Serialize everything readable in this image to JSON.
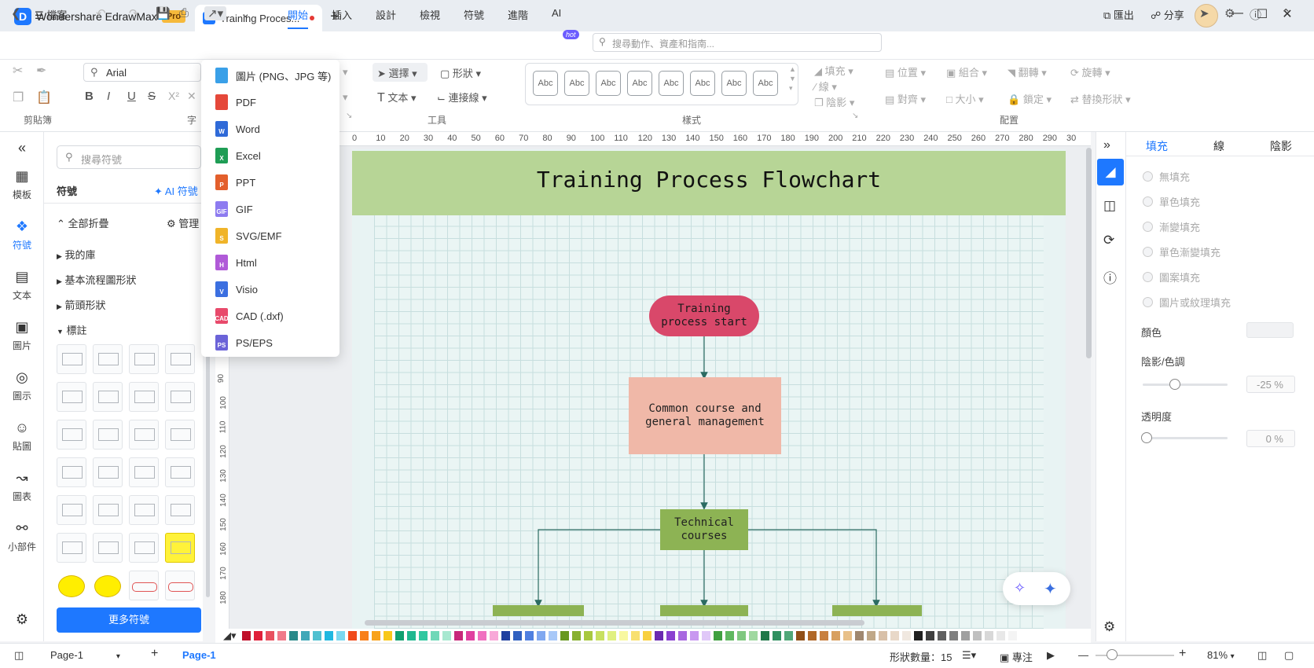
{
  "app": {
    "name": "Wondershare EdrawMax",
    "badge": "Pro"
  },
  "doc_tab": {
    "title": "Training Proces...",
    "icon": "E"
  },
  "menubar": {
    "file": "檔案",
    "tabs": [
      "開始",
      "插入",
      "設計",
      "檢視",
      "符號",
      "進階",
      "AI"
    ],
    "hot": "hot",
    "search_placeholder": "搜尋動作、資產和指南...",
    "export": "匯出",
    "share": "分享"
  },
  "ribbon": {
    "font": "Arial",
    "clipboard_label": "剪貼簿",
    "font_label_partial": "字",
    "tools_label": "工具",
    "styles_label": "樣式",
    "arrange_label": "配置",
    "select": "選擇",
    "shape": "形狀",
    "text": "文本",
    "connector": "連接線",
    "fill": "填充",
    "line": "線",
    "shadow": "陰影",
    "position": "位置",
    "group": "組合",
    "flip": "翻轉",
    "rotate": "旋轉",
    "align": "對齊",
    "size": "大小",
    "lock": "鎖定",
    "replace_shape": "替換形狀",
    "abc": "Abc"
  },
  "leftrail": [
    "模板",
    "符號",
    "文本",
    "圖片",
    "圖示",
    "貼圖",
    "圖表",
    "小部件"
  ],
  "symbols": {
    "search_placeholder": "搜尋符號",
    "title": "符號",
    "ai_symbols": "AI 符號",
    "collapse_all": "全部折疊",
    "manage": "管理",
    "categories": [
      "我的庫",
      "基本流程圖形狀",
      "箭頭形狀",
      "標註"
    ],
    "more_button": "更多符號"
  },
  "export_menu": [
    {
      "label": "圖片 (PNG、JPG 等)",
      "color": "#3aa0e8",
      "tag": ""
    },
    {
      "label": "PDF",
      "color": "#e5483a",
      "tag": ""
    },
    {
      "label": "Word",
      "color": "#2f6ad8",
      "tag": "W"
    },
    {
      "label": "Excel",
      "color": "#1f9d55",
      "tag": "X"
    },
    {
      "label": "PPT",
      "color": "#e35f2c",
      "tag": "P"
    },
    {
      "label": "GIF",
      "color": "#8d7bf0",
      "tag": "GIF"
    },
    {
      "label": "SVG/EMF",
      "color": "#f0b429",
      "tag": "S"
    },
    {
      "label": "Html",
      "color": "#b05ad8",
      "tag": "H"
    },
    {
      "label": "Visio",
      "color": "#3b6fe0",
      "tag": "V"
    },
    {
      "label": "CAD (.dxf)",
      "color": "#e84a6b",
      "tag": "CAD"
    },
    {
      "label": "PS/EPS",
      "color": "#6b63d8",
      "tag": "PS"
    }
  ],
  "ruler_h": [
    "0",
    "10",
    "20",
    "30",
    "40",
    "50",
    "60",
    "70",
    "80",
    "90",
    "100",
    "110",
    "120",
    "130",
    "140",
    "150",
    "160",
    "170",
    "180",
    "190",
    "200",
    "210",
    "220",
    "230",
    "240",
    "250",
    "260",
    "270",
    "280",
    "290",
    "30"
  ],
  "ruler_v": [
    "90",
    "100",
    "110",
    "120",
    "130",
    "140",
    "150",
    "160",
    "170",
    "180"
  ],
  "diagram": {
    "title": "Training Process Flowchart",
    "start": "Training\nprocess start",
    "common": "Common course and\ngeneral management",
    "technical": "Technical\ncourses",
    "colors": {
      "banner": "#b7d596",
      "start": "#d9486a",
      "common": "#f0b8a8",
      "technical": "#8db354"
    }
  },
  "rightpanel": {
    "tabs": [
      "填充",
      "線",
      "陰影"
    ],
    "fill_options": [
      "無填充",
      "單色填充",
      "漸變填充",
      "單色漸變填充",
      "圖案填充",
      "圖片或紋理填充"
    ],
    "color_label": "顏色",
    "shade_label": "陰影/色調",
    "shade_value": "-25 %",
    "transparency_label": "透明度",
    "transparency_value": "0 %"
  },
  "status": {
    "page_select": "Page-1",
    "page_tab": "Page-1",
    "shape_count_label": "形狀數量：",
    "shape_count": "15",
    "focus": "專注",
    "zoom": "81%"
  },
  "palette": [
    "#c0102a",
    "#e0203a",
    "#e8505f",
    "#f07a8a",
    "#2a8a8a",
    "#40a8b8",
    "#50c0d0",
    "#20b8e0",
    "#7ad8f0",
    "#f04a1a",
    "#f8801a",
    "#f8a21a",
    "#f8c81a",
    "#10a070",
    "#20b890",
    "#30c8a0",
    "#70d8b8",
    "#a8e8d0",
    "#c8287a",
    "#e040a0",
    "#f070c0",
    "#f8a8d8",
    "#2040a0",
    "#3060c0",
    "#5080e0",
    "#80a8f0",
    "#a8c8f8",
    "#689820",
    "#88b030",
    "#a8c840",
    "#c8e060",
    "#e0f080",
    "#f8f8a0",
    "#f8e070",
    "#f8d040",
    "#6a2ab0",
    "#8a40d0",
    "#a868e0",
    "#c898f0",
    "#e0c8f8",
    "#40a040",
    "#60b860",
    "#80c880",
    "#a0d8a0",
    "#207848",
    "#309060",
    "#50a878",
    "#905018",
    "#b06828",
    "#c88040",
    "#d8a060",
    "#e8c088",
    "#a08870",
    "#c0a888",
    "#d8c0a8",
    "#e8d8c8",
    "#f0e8e0",
    "#202020",
    "#404040",
    "#606060",
    "#808080",
    "#a0a0a0",
    "#c0c0c0",
    "#d8d8d8",
    "#e8e8e8",
    "#f4f4f4",
    "#ffffff"
  ]
}
